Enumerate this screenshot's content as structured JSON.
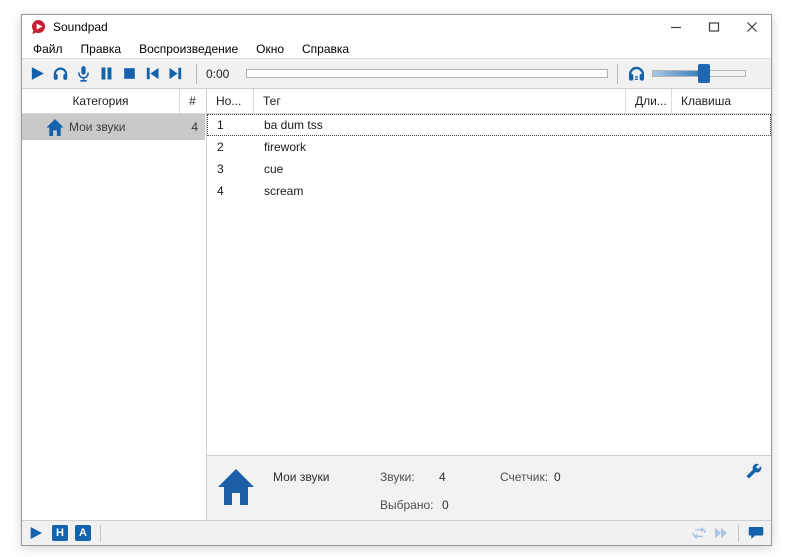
{
  "window": {
    "title": "Soundpad"
  },
  "menu": {
    "items": [
      {
        "label": "Файл"
      },
      {
        "label": "Правка"
      },
      {
        "label": "Воспроизведение"
      },
      {
        "label": "Окно"
      },
      {
        "label": "Справка"
      }
    ]
  },
  "toolbar": {
    "time": "0:00",
    "progress_percent": 0,
    "volume_percent": 55
  },
  "sidebar": {
    "column_category": "Категория",
    "column_count": "#",
    "items": [
      {
        "label": "Мои звуки",
        "count": "4",
        "selected": true
      }
    ]
  },
  "sound_list": {
    "columns": [
      {
        "label": "Но..."
      },
      {
        "label": "Тег"
      },
      {
        "label": "Дли..."
      },
      {
        "label": "Клавиша"
      }
    ],
    "rows": [
      {
        "number": "1",
        "tag": "ba dum tss",
        "duration": "",
        "hotkey": "",
        "focused": true
      },
      {
        "number": "2",
        "tag": "firework",
        "duration": "",
        "hotkey": ""
      },
      {
        "number": "3",
        "tag": "cue",
        "duration": "",
        "hotkey": ""
      },
      {
        "number": "4",
        "tag": "scream",
        "duration": "",
        "hotkey": ""
      }
    ]
  },
  "info_panel": {
    "category_label": "Мои звуки",
    "sounds_label": "Звуки:",
    "sounds_value": "4",
    "counter_label": "Счетчик:",
    "counter_value": "0",
    "selected_label": "Выбрано:",
    "selected_value": "0"
  },
  "status_bar": {
    "hotkeys_badge": "H",
    "autoplay_badge": "A"
  },
  "icons": {
    "logo": "red-speech-bubble-with-play",
    "play": "triangle-right",
    "listen": "headphones",
    "record": "microphone",
    "pause": "pause-bars",
    "stop": "square",
    "previous": "skip-back",
    "next": "skip-forward",
    "volume": "headphones",
    "category": "house",
    "settings": "wrench",
    "repeat": "loop-arrows",
    "play-next": "double-chevron",
    "feedback": "speech-bubble",
    "minimize": "minus",
    "maximize": "square-outline",
    "close": "x"
  },
  "colors": {
    "accent_blue": "#1461ac",
    "logo_red": "#c41e33",
    "disabled_blue": "#a9c6e4",
    "selected_gray": "#c9c9c9",
    "toolbar_gray": "#f1f1f1"
  }
}
